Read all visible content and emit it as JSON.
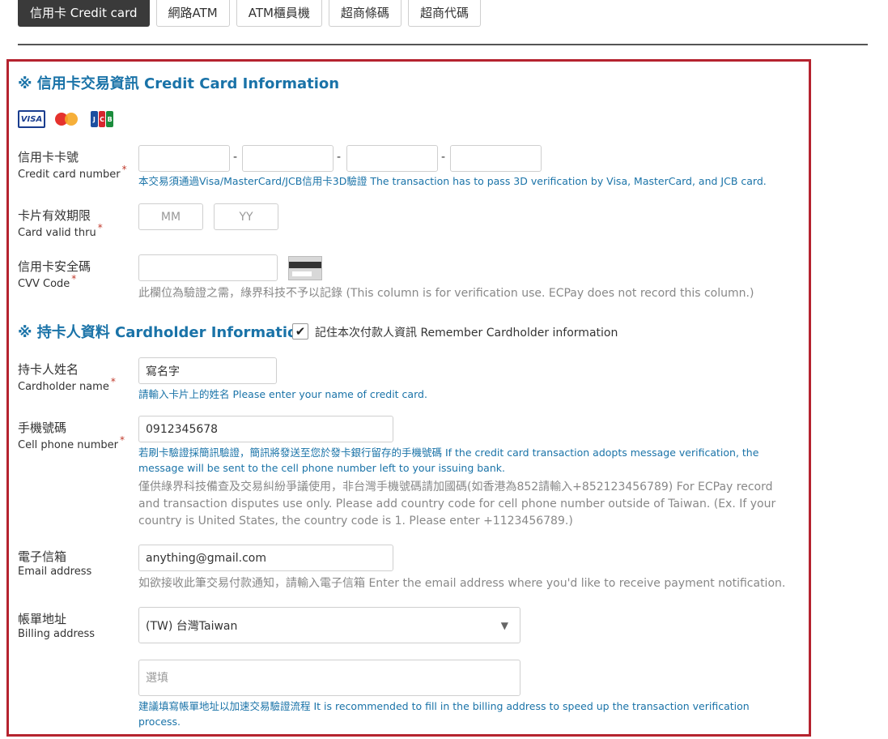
{
  "tabs": [
    {
      "label": "信用卡 Credit card",
      "active": true
    },
    {
      "label": "網路ATM",
      "active": false
    },
    {
      "label": "ATM櫃員機",
      "active": false
    },
    {
      "label": "超商條碼",
      "active": false
    },
    {
      "label": "超商代碼",
      "active": false
    }
  ],
  "credit_section": {
    "title": "※ 信用卡交易資訊 Credit Card Information",
    "card_brands": [
      "visa-icon",
      "mastercard-icon",
      "jcb-icon"
    ],
    "visa_text": "VISA",
    "card_number": {
      "label_zh": "信用卡卡號",
      "label_en": "Credit card number",
      "required_mark": "*",
      "separator": "-",
      "hint": "本交易須通過Visa/MasterCard/JCB信用卡3D驗證 The transaction has to pass 3D verification by Visa, MasterCard, and JCB card."
    },
    "valid_thru": {
      "label_zh": "卡片有效期限",
      "label_en": "Card valid thru",
      "required_mark": "*",
      "month_placeholder": "MM",
      "year_placeholder": "YY"
    },
    "cvv": {
      "label_zh": "信用卡安全碼",
      "label_en": "CVV Code",
      "required_mark": "*",
      "hint": "此欄位為驗證之需，綠界科技不予以記錄 (This column is for verification use. ECPay does not record this column.)"
    }
  },
  "cardholder_section": {
    "title": "※ 持卡人資料 Cardholder Information",
    "remember_checked": true,
    "remember_label": "記住本次付款人資訊 Remember Cardholder information",
    "name": {
      "label_zh": "持卡人姓名",
      "label_en": "Cardholder name",
      "required_mark": "*",
      "value": "寫名字",
      "hint": "請輸入卡片上的姓名 Please enter your name of credit card."
    },
    "phone": {
      "label_zh": "手機號碼",
      "label_en": "Cell phone number",
      "required_mark": "*",
      "value": "0912345678",
      "hint_blue": "若刷卡驗證採簡訊驗證，簡訊將發送至您於發卡銀行留存的手機號碼 If the credit card transaction adopts message verification, the message will be sent to the cell phone number left to your issuing bank.",
      "hint_gray": "僅供綠界科技備查及交易糾紛爭議使用，非台灣手機號碼請加國碼(如香港為852請輸入+852123456789) For ECPay record and transaction disputes use only. Please add country code for cell phone number outside of Taiwan. (Ex. If your country is United States, the country code is 1. Please enter +1123456789.)"
    },
    "email": {
      "label_zh": "電子信箱",
      "label_en": "Email address",
      "value": "anything@gmail.com",
      "hint": "如欲接收此筆交易付款通知，請輸入電子信箱 Enter the email address where you'd like to receive payment notification."
    },
    "billing": {
      "label_zh": "帳單地址",
      "label_en": "Billing address",
      "country_selected": "(TW) 台灣Taiwan",
      "address_placeholder": "選填",
      "hint": "建議填寫帳單地址以加速交易驗證流程 It is recommended to fill in the billing address to speed up the transaction verification process."
    }
  }
}
